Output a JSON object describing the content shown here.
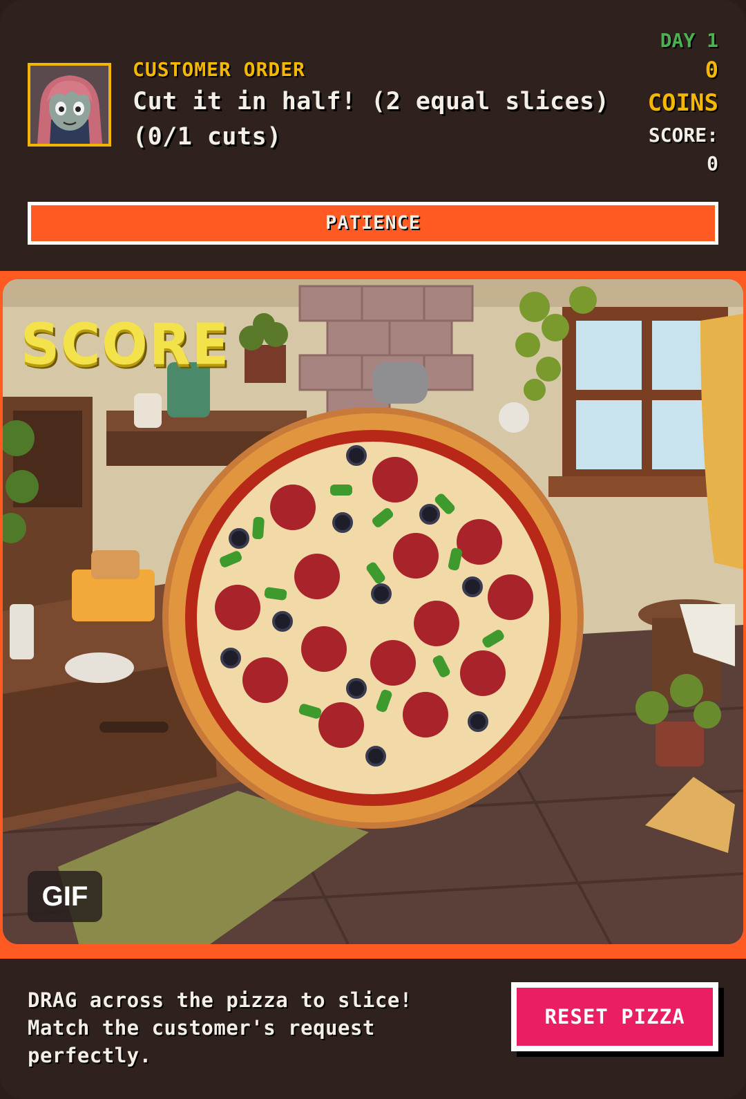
{
  "order": {
    "label": "CUSTOMER ORDER",
    "request": "Cut it in half! (2 equal slices)",
    "progress": "(0/1 cuts)"
  },
  "stats": {
    "day": "DAY 1",
    "coins_value": "0",
    "coins_label": "COINS",
    "score_label": "SCORE:",
    "score_value": "0"
  },
  "patience": {
    "label": "PATIENCE",
    "level": 1.0,
    "color": "#ff5a22"
  },
  "scene": {
    "score_art": "SCORE",
    "gif_badge": "GIF"
  },
  "footer": {
    "instructions": "DRAG across the pizza to slice! Match the customer's request perfectly.",
    "reset_label": "RESET PIZZA"
  },
  "colors": {
    "accent": "#ff5a22",
    "reset_button": "#e91e63",
    "gold": "#f5b800",
    "green": "#4caf50",
    "background": "#2f211d"
  }
}
